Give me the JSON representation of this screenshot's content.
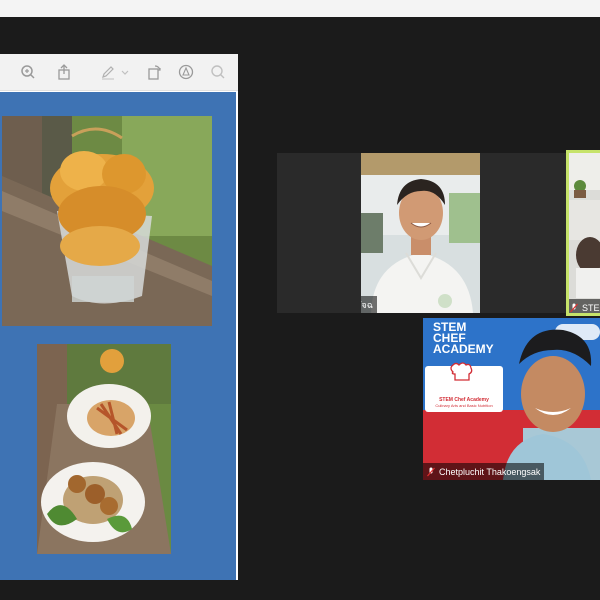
{
  "viewer": {
    "toolbar_icons": [
      "zoom-in-icon",
      "share-icon",
      "markup-pen-icon",
      "rotate-icon",
      "annotate-icon",
      "search-icon"
    ]
  },
  "participants": [
    {
      "name": "ป้าง-สรัทธา พระอัจฉ",
      "muted": true
    },
    {
      "name": "STE",
      "muted": true
    },
    {
      "name": "Chetpluchit Thakoengsak",
      "muted": true
    }
  ],
  "banner": {
    "line1": "STEM",
    "line2": "CHEF",
    "line3": "ACADEMY",
    "badge_title": "STEM Chef Academy",
    "badge_sub": "Culinary Arts and Basic Nutrition"
  },
  "colors": {
    "active_speaker_border": "#c6e36a",
    "doc_page_blue": "#3e73b4",
    "banner_blue": "#2d73c9",
    "banner_red": "#d22d35"
  }
}
